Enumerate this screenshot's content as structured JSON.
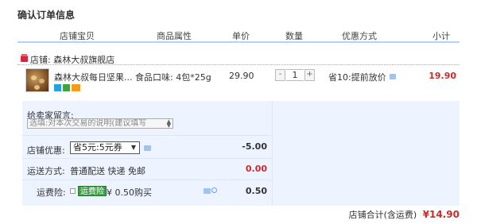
{
  "page": {
    "title": "确认订单信息"
  },
  "columns": {
    "item": "店铺宝贝",
    "attributes": "商品属性",
    "price": "单价",
    "quantity": "数量",
    "promotion": "优惠方式",
    "subtotal": "小计"
  },
  "shop": {
    "label": "店铺: 森林大叔旗舰店"
  },
  "item": {
    "title": "森林大叔每日坚果...",
    "attributes": "食品口味: 4包*25g",
    "price": "29.90",
    "quantity": "1",
    "quantity_minus": "-",
    "quantity_plus": "+",
    "promotion": "省10:提前放价",
    "subtotal": "19.90"
  },
  "message": {
    "label": "给卖家留言:",
    "placeholder": "选填:对本次交易的说明(建议填写"
  },
  "discount": {
    "label": "店铺优惠:",
    "selected": "省5元:5元券",
    "amount": "-5.00"
  },
  "shipping": {
    "label": "运送方式:",
    "method": "普通配送 快递 免邮",
    "amount": "0.00"
  },
  "insurance": {
    "label": "运费险:",
    "tag": "运费险",
    "desc": "¥ 0.50购买",
    "amount": "0.50"
  },
  "total": {
    "label": "店铺合计(含运费)",
    "value": "¥14.90"
  },
  "colors": {
    "accent_red": "#cc2a2a",
    "header_line": "#b2d1ff",
    "panel_bg": "#eef4ff",
    "insurance_green": "#3c9e46"
  }
}
